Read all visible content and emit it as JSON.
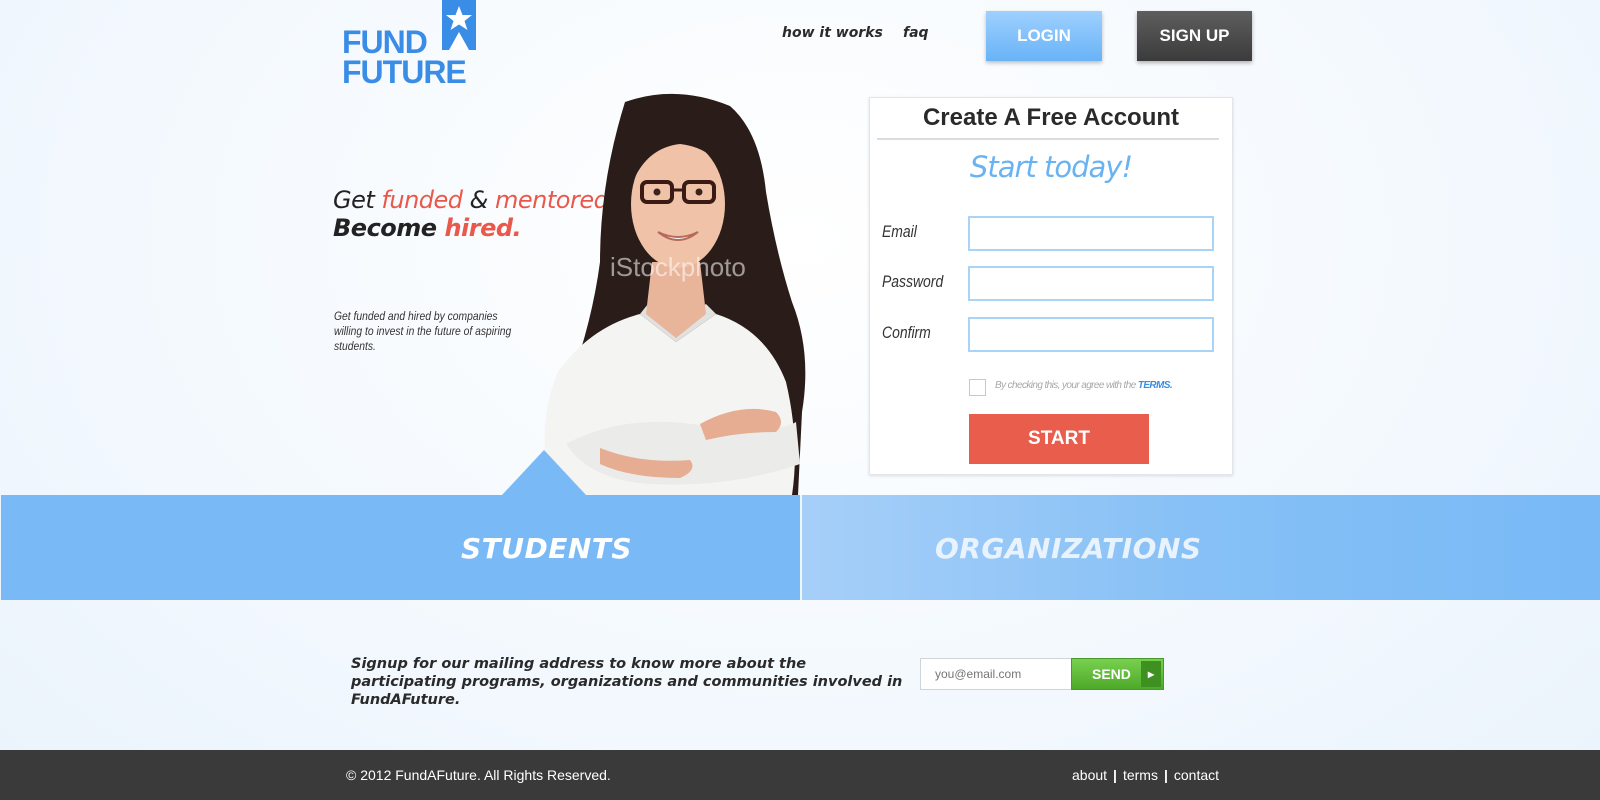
{
  "brand": {
    "line1": "FUND",
    "line2": "FUTURE",
    "logo_icon": "star-icon",
    "color": "#3a8de6"
  },
  "nav": {
    "how_it_works": "how it works",
    "faq": "faq",
    "login": "LOGIN",
    "signup": "SIGN UP"
  },
  "hero": {
    "tag1_get": "Get ",
    "tag1_funded": "funded",
    "tag1_amp": " & ",
    "tag1_mentored": "mentored.",
    "tag2_become": "Become ",
    "tag2_hired": "hired.",
    "description": "Get funded and hired by companies willing to invest in the future of aspiring students.",
    "photo_watermark": "iStockphoto",
    "accent_color": "#e9584a"
  },
  "signup_form": {
    "title": "Create A Free Account",
    "subtitle": "Start today!",
    "email_label": "Email",
    "password_label": "Password",
    "confirm_label": "Confirm",
    "email_value": "",
    "password_value": "",
    "confirm_value": "",
    "terms_prefix": "By checking this, your agree with the ",
    "terms_link": "TERMS.",
    "terms_checked": false,
    "start_button": "START"
  },
  "audience": {
    "students": "STUDENTS",
    "organizations": "ORGANIZATIONS"
  },
  "newsletter": {
    "text": "Signup for our mailing address to know more about the participating programs, organizations and communities involved in FundAFuture.",
    "placeholder": "you@email.com",
    "send": "SEND",
    "arrow_icon": "chevron-right-icon"
  },
  "footer": {
    "copyright": "© 2012 FundAFuture.  All Rights Reserved.",
    "about": "about",
    "terms": "terms",
    "contact": "contact",
    "separator": "|"
  }
}
